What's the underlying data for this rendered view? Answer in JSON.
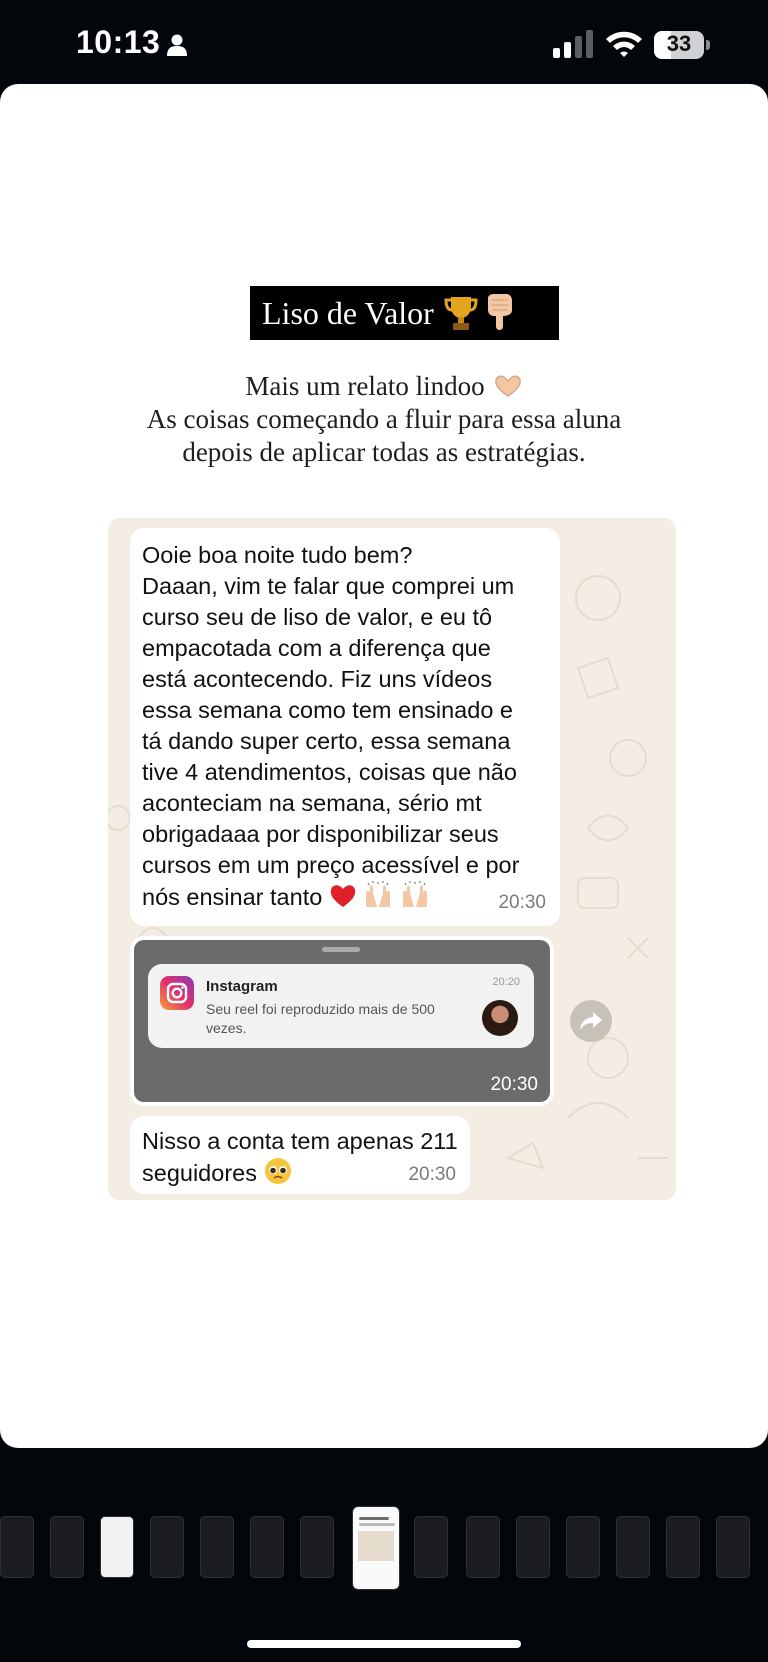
{
  "status_bar": {
    "time": "10:13",
    "battery_level": "33",
    "battery_fraction": 0.33
  },
  "story": {
    "title": "Liso de Valor",
    "title_icons": [
      "trophy-icon",
      "pointing-down-icon"
    ],
    "caption_lines": [
      "Mais um relato lindoo",
      "As coisas começando a fluir para essa aluna",
      "depois de aplicar todas as estratégias."
    ]
  },
  "chat": {
    "message_1": {
      "lines": [
        "Ooie boa noite tudo bem?",
        "Daaan, vim te falar que comprei um",
        "curso seu de liso de valor, e eu tô",
        "empacotada com a diferença que",
        "está acontecendo. Fiz uns vídeos",
        "essa semana como tem ensinado e",
        "tá dando super certo, essa semana",
        "tive 4 atendimentos, coisas que não",
        "aconteciam na semana, sério mt",
        "obrigadaaa por disponibilizar seus",
        "cursos em um preço acessível e por",
        "nós ensinar tanto"
      ],
      "time": "20:30"
    },
    "message_2": {
      "notification": {
        "app": "Instagram",
        "time": "20:20",
        "text": "Seu reel foi reproduzido mais de 500 vezes."
      },
      "time": "20:30"
    },
    "message_3": {
      "lines": [
        "Nisso a conta tem apenas 211",
        "seguidores"
      ],
      "time": "20:30"
    }
  },
  "colors": {
    "story_bg": "#ffffff",
    "chat_bg": "#f4ede3",
    "bubble": "#ffffff",
    "title_box": "#000000",
    "screen_bg": "#03070b"
  }
}
